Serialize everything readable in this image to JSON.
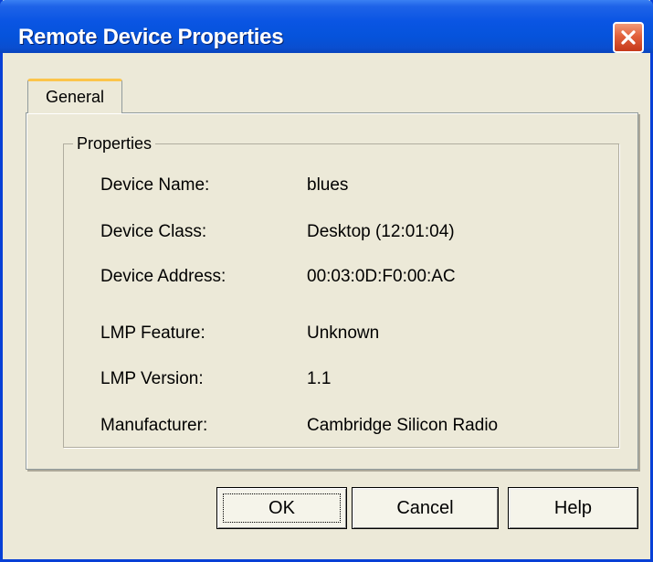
{
  "window": {
    "title": "Remote Device Properties"
  },
  "tabs": [
    {
      "label": "General"
    }
  ],
  "properties": {
    "group_label": "Properties",
    "rows": [
      {
        "label": "Device Name:",
        "value": "blues"
      },
      {
        "label": "Device Class:",
        "value": "Desktop (12:01:04)"
      },
      {
        "label": "Device Address:",
        "value": "00:03:0D:F0:00:AC"
      },
      {
        "label": "LMP Feature:",
        "value": "Unknown"
      },
      {
        "label": "LMP Version:",
        "value": "1.1"
      },
      {
        "label": "Manufacturer:",
        "value": "Cambridge Silicon Radio"
      }
    ]
  },
  "buttons": {
    "ok": "OK",
    "cancel": "Cancel",
    "help": "Help"
  },
  "colors": {
    "titlebar": "#0a55e3",
    "close_button": "#e2613c",
    "window_bg": "#ece9d8",
    "tab_highlight": "#fcc44a"
  },
  "icons": {
    "close": "close-icon"
  }
}
